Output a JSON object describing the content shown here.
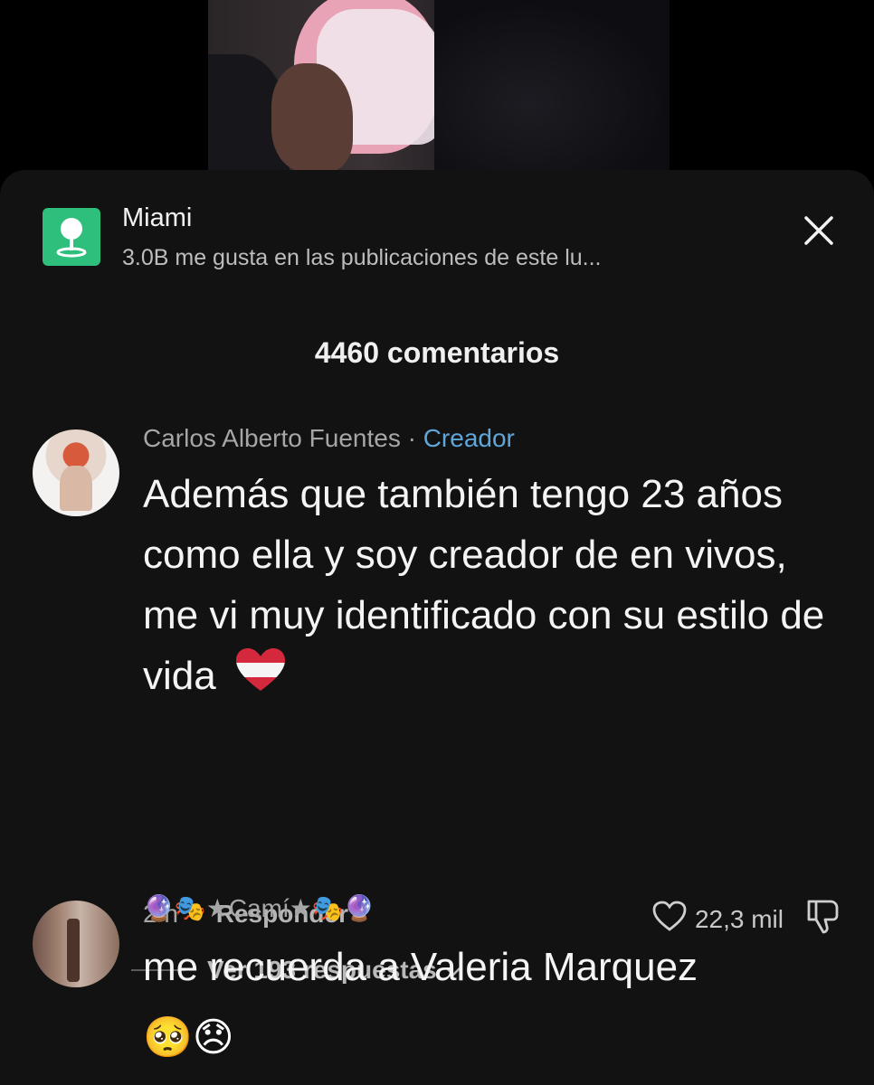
{
  "location": {
    "title": "Miami",
    "subtitle": "3.0B me gusta en las publicaciones de este lu...",
    "icon": "map-pin-icon",
    "accent": "#2fbf7d"
  },
  "comments_header": "4460 comentarios",
  "comments": [
    {
      "author": "Carlos Alberto Fuentes",
      "separator": " · ",
      "badge": "Creador",
      "text": "Además que también tengo 23 años como ella y soy creador de en vivos, me vi muy identificado con su estilo de vida",
      "emoji": "heart-flag-emoji",
      "time": "2 h",
      "reply_label": "Responder",
      "likes": "22,3 mil",
      "view_replies": "Ver 193 respuestas"
    },
    {
      "author": "🔮🎭★Camí★🎭🔮",
      "text": "me recuerda a Valeria Marquez",
      "emojis": [
        "🥺",
        "😞"
      ]
    }
  ],
  "colors": {
    "sheet_bg": "#121212",
    "creator_badge": "#5fa6d9",
    "muted_text": "#a6a6a6"
  }
}
